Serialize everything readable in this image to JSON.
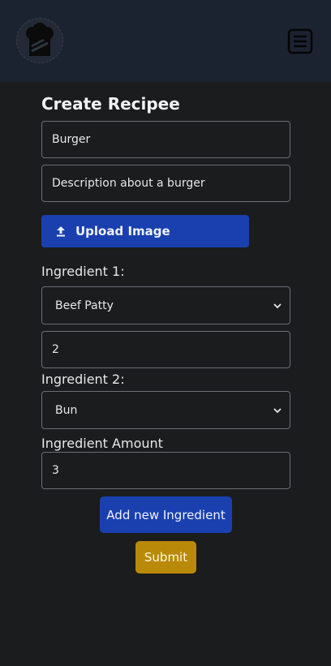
{
  "header": {
    "logo_icon": "chef-hat-logo-icon",
    "menu_icon": "hamburger-menu-icon"
  },
  "form": {
    "title": "Create Recipee",
    "name_value": "Burger",
    "description_value": "Description about a burger",
    "upload_label": "Upload Image",
    "upload_icon": "upload-arrow-icon",
    "ingredients": [
      {
        "label": "Ingredient 1:",
        "selected": "Beef Patty",
        "amount": "2"
      },
      {
        "label": "Ingredient 2:",
        "selected": "Bun",
        "amount_label": "Ingredient Amount",
        "amount": "3"
      }
    ],
    "add_ingredient_label": "Add new Ingredient",
    "submit_label": "Submit"
  },
  "colors": {
    "header_bg": "#1c2330",
    "page_bg": "#1b1c1e",
    "primary": "#1a40b0",
    "submit": "#b98a0a"
  }
}
